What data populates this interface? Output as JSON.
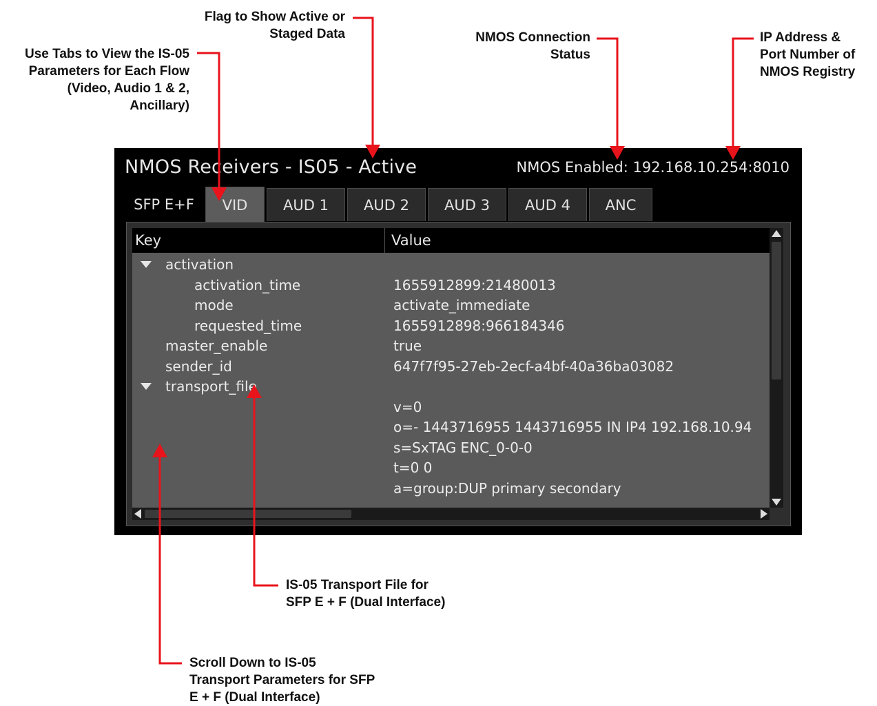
{
  "annotations": {
    "tabs_note": [
      "Use Tabs to View the IS-05",
      "Parameters for Each Flow",
      "(Video, Audio 1 & 2,",
      "Ancillary)"
    ],
    "flag_note": [
      "Flag to Show Active or",
      "Staged Data"
    ],
    "status_note": [
      "NMOS Connection",
      "Status"
    ],
    "registry_note": [
      "IP Address &",
      "Port Number of",
      "NMOS Registry"
    ],
    "transport_note": [
      "IS-05 Transport File for",
      "SFP E + F (Dual Interface)"
    ],
    "scroll_note": [
      "Scroll Down to IS-05",
      "Transport Parameters for SFP",
      "E + F (Dual Interface)"
    ]
  },
  "panel": {
    "title": "NMOS Receivers - IS05 - Active",
    "status": "NMOS Enabled: 192.168.10.254:8010",
    "tabs": [
      {
        "label": "SFP E+F"
      },
      {
        "label": "VID"
      },
      {
        "label": "AUD 1"
      },
      {
        "label": "AUD 2"
      },
      {
        "label": "AUD 3"
      },
      {
        "label": "AUD 4"
      },
      {
        "label": "ANC"
      }
    ],
    "active_tab": "VID",
    "tree": {
      "header_key": "Key",
      "header_value": "Value",
      "rows": [
        {
          "key": "activation",
          "value": ""
        },
        {
          "key": "activation_time",
          "value": "1655912899:21480013"
        },
        {
          "key": "mode",
          "value": "activate_immediate"
        },
        {
          "key": "requested_time",
          "value": "1655912898:966184346"
        },
        {
          "key": "master_enable",
          "value": "true"
        },
        {
          "key": "sender_id",
          "value": "647f7f95-27eb-2ecf-a4bf-40a36ba03082"
        },
        {
          "key": "transport_file",
          "value": ""
        },
        {
          "key": "",
          "value": "v=0"
        },
        {
          "key": "",
          "value": "o=- 1443716955 1443716955 IN IP4 192.168.10.94"
        },
        {
          "key": "",
          "value": "s=SxTAG ENC_0-0-0"
        },
        {
          "key": "",
          "value": "t=0 0"
        },
        {
          "key": "",
          "value": "a=group:DUP primary secondary"
        }
      ]
    }
  },
  "colors": {
    "arrow": "#e8131b",
    "panel_bg": "#000000",
    "tree_bg": "#5a5a5a",
    "active_tab_bg": "#5c5c5c"
  }
}
